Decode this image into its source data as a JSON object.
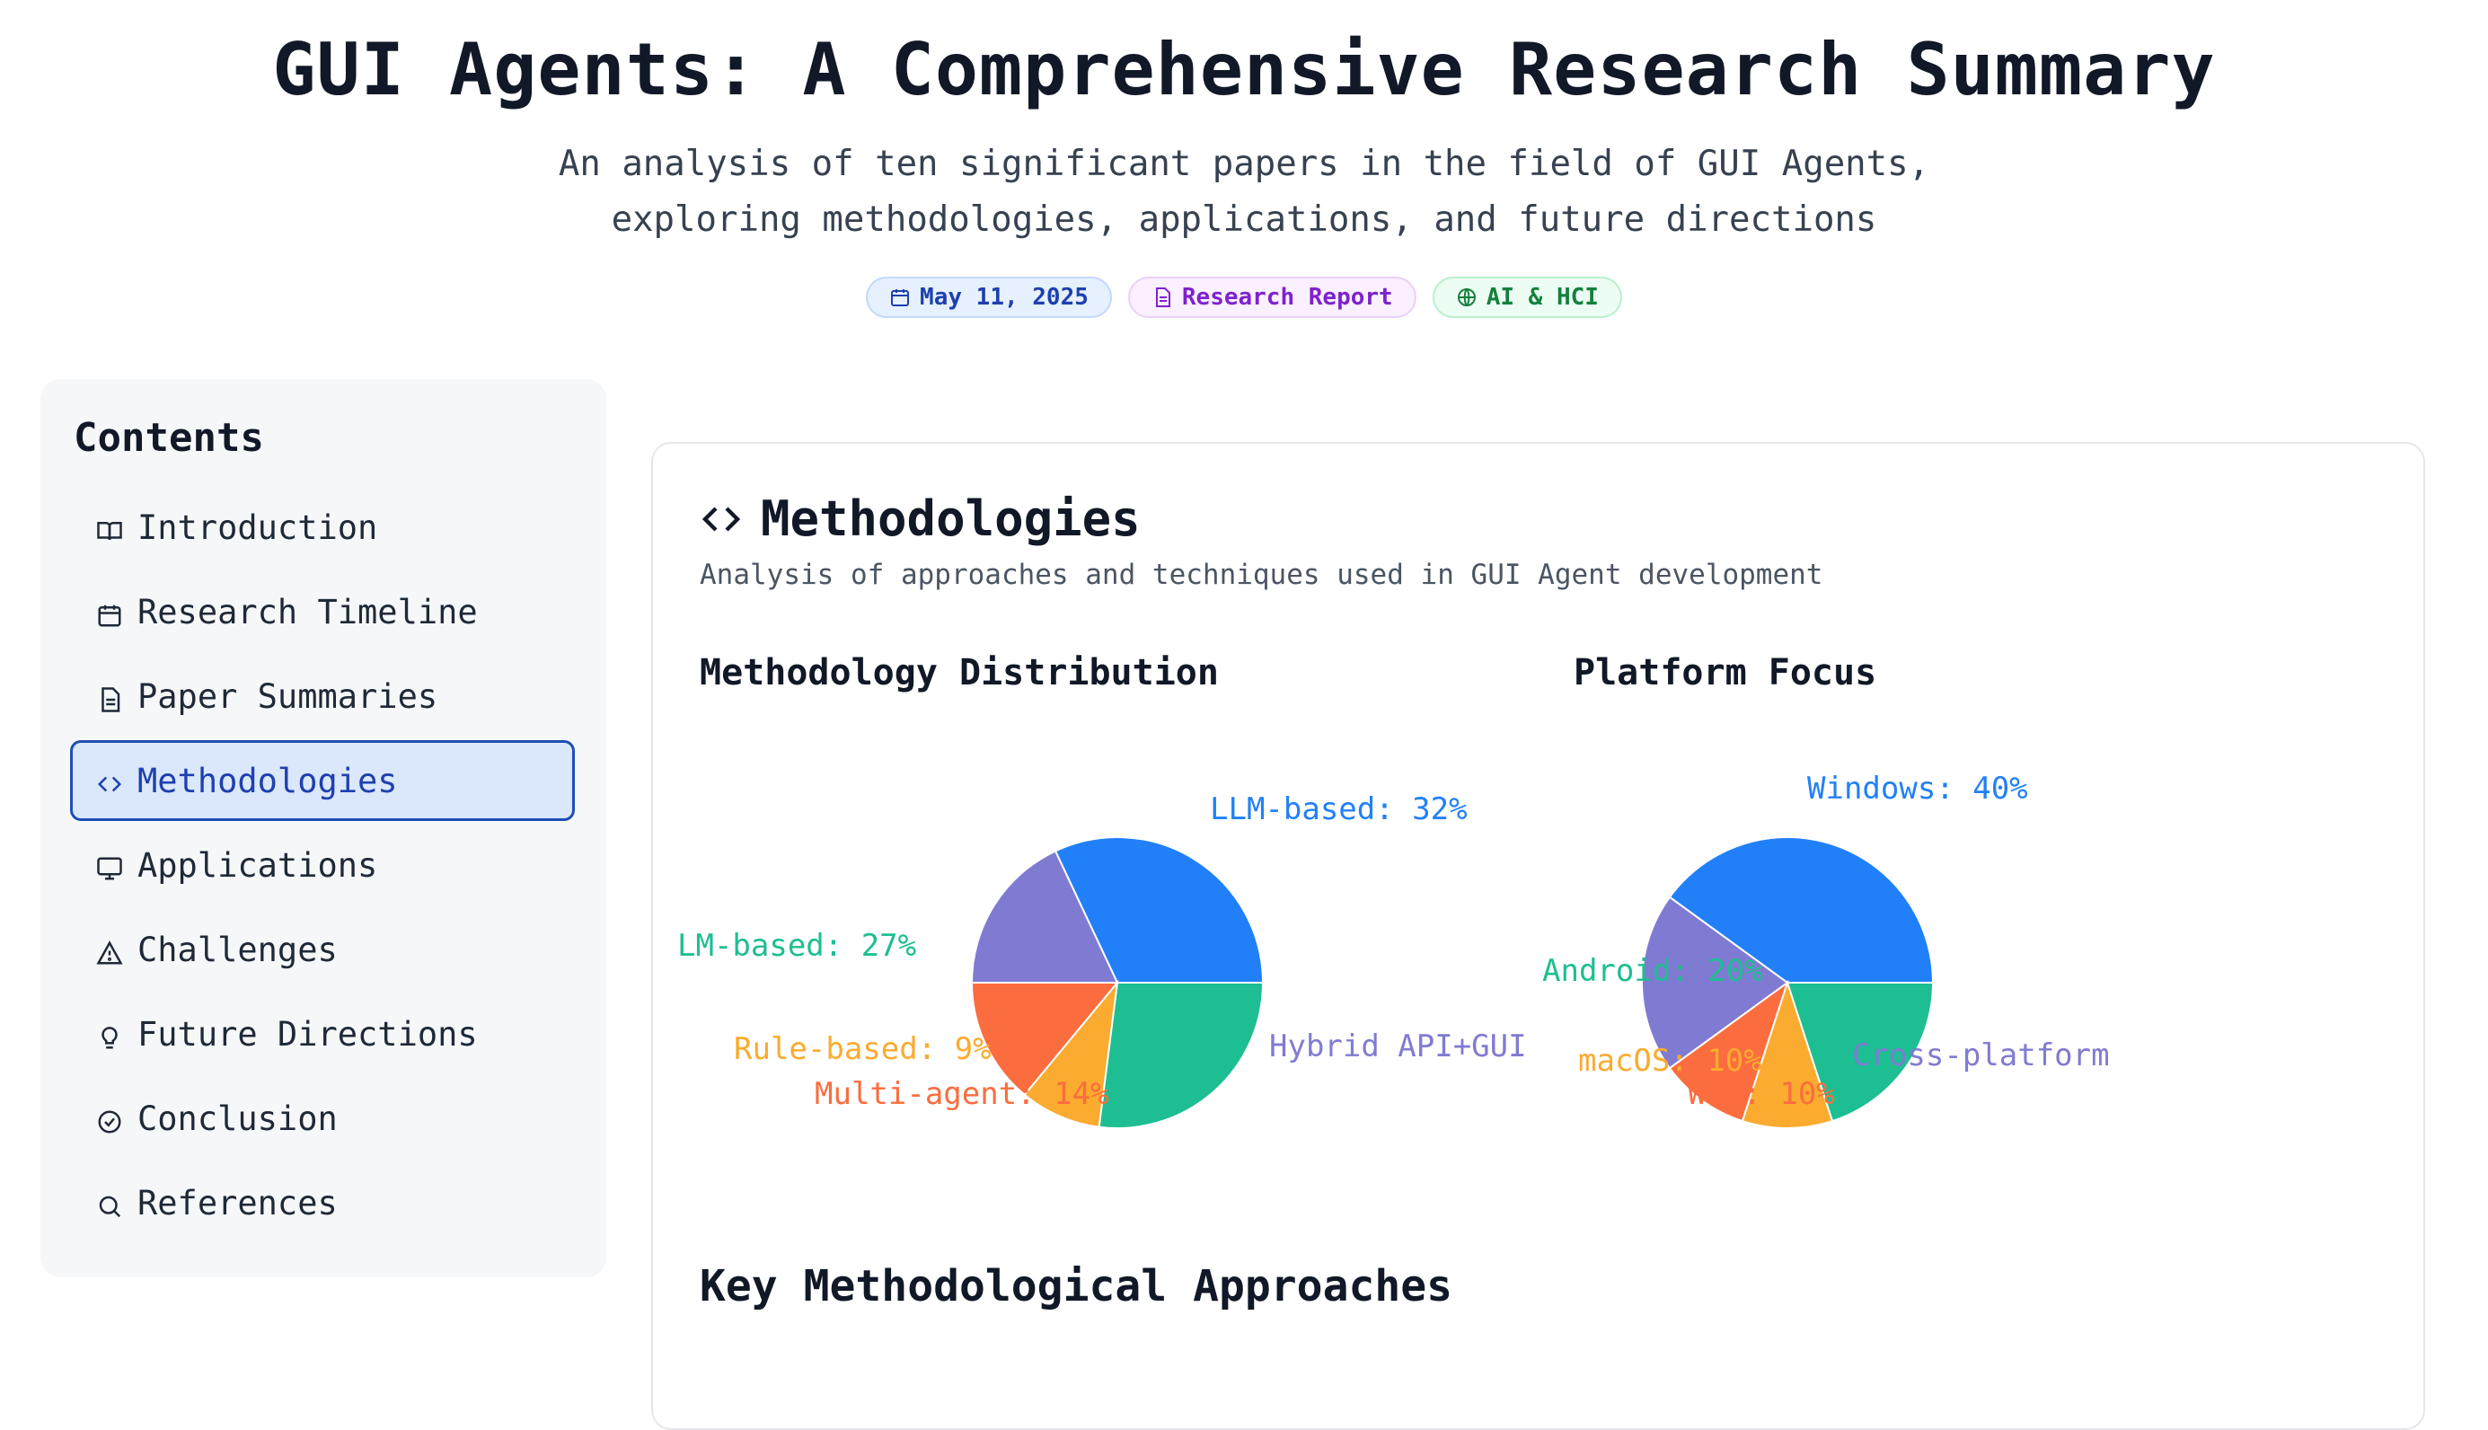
{
  "header": {
    "title": "GUI Agents: A Comprehensive Research Summary",
    "subtitle_line1": "An analysis of ten significant papers in the field of GUI Agents,",
    "subtitle_line2": "exploring methodologies, applications, and future directions",
    "badges": [
      {
        "label": "May 11, 2025",
        "icon": "calendar-icon"
      },
      {
        "label": "Research Report",
        "icon": "document-icon"
      },
      {
        "label": "AI & HCI",
        "icon": "globe-icon"
      }
    ]
  },
  "sidebar": {
    "title": "Contents",
    "items": [
      {
        "label": "Introduction",
        "icon": "book-icon"
      },
      {
        "label": "Research Timeline",
        "icon": "calendar-icon"
      },
      {
        "label": "Paper Summaries",
        "icon": "document-icon"
      },
      {
        "label": "Methodologies",
        "icon": "code-icon",
        "active": true
      },
      {
        "label": "Applications",
        "icon": "monitor-icon"
      },
      {
        "label": "Challenges",
        "icon": "warning-icon"
      },
      {
        "label": "Future Directions",
        "icon": "lightbulb-icon"
      },
      {
        "label": "Conclusion",
        "icon": "check-circle-icon"
      },
      {
        "label": "References",
        "icon": "search-icon"
      }
    ]
  },
  "section": {
    "title": "Methodologies",
    "description": "Analysis of approaches and techniques used in GUI Agent development",
    "subheading": "Key Methodological Approaches"
  },
  "colors": {
    "blue": "#2180f8",
    "teal": "#1dbe92",
    "orange": "#fbab2f",
    "red": "#fb6d3e",
    "purple": "#807bd2"
  },
  "chart_data": [
    {
      "type": "pie",
      "title": "Methodology Distribution",
      "labels": [
        "LLM-based: 32%",
        "Hybrid API+GUI",
        "Multi-agent: 14%",
        "Rule-based: 9%",
        "LM-based: 27%"
      ],
      "values": [
        32,
        18,
        14,
        9,
        27
      ],
      "colors": [
        "#2180f8",
        "#807bd2",
        "#fb6d3e",
        "#fbab2f",
        "#1dbe92"
      ]
    },
    {
      "type": "pie",
      "title": "Platform Focus",
      "labels": [
        "Windows: 40%",
        "Cross-platform",
        "Web: 10%",
        "macOS: 10%",
        "Android: 20%"
      ],
      "values": [
        40,
        20,
        10,
        10,
        20
      ],
      "colors": [
        "#2180f8",
        "#807bd2",
        "#fb6d3e",
        "#fbab2f",
        "#1dbe92"
      ]
    }
  ]
}
